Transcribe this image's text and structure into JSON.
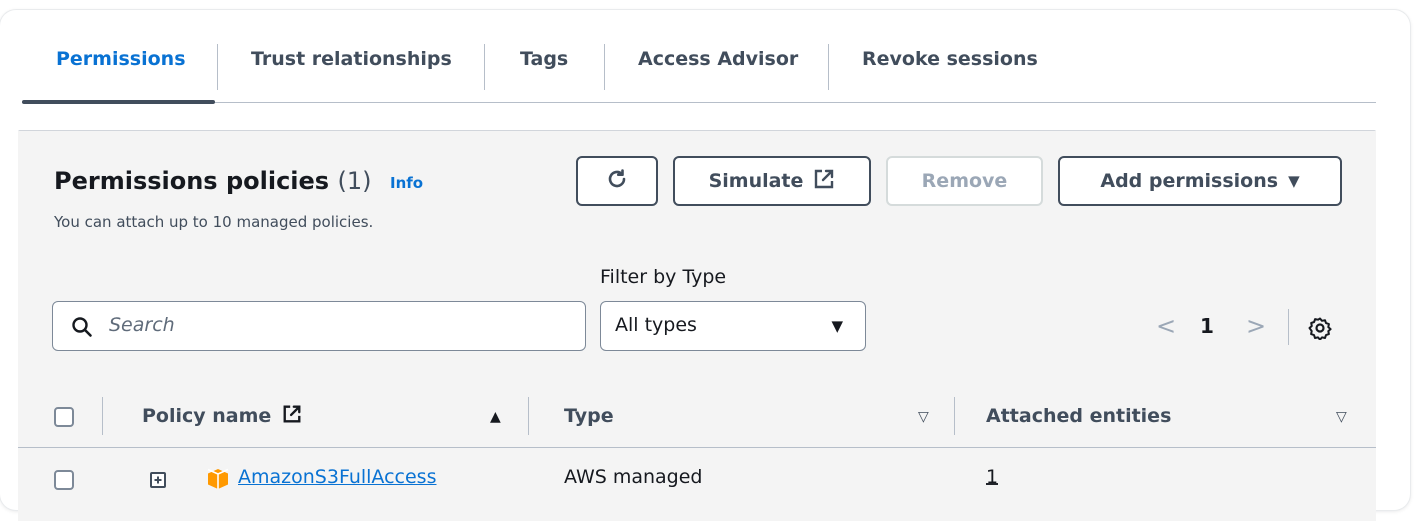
{
  "tabs": [
    {
      "label": "Permissions",
      "active": true
    },
    {
      "label": "Trust relationships",
      "active": false
    },
    {
      "label": "Tags",
      "active": false
    },
    {
      "label": "Access Advisor",
      "active": false
    },
    {
      "label": "Revoke sessions",
      "active": false
    }
  ],
  "panel": {
    "title": "Permissions policies",
    "count": "(1)",
    "info_link": "Info",
    "subtitle": "You can attach up to 10 managed policies."
  },
  "actions": {
    "refresh_icon": "refresh-icon",
    "simulate_label": "Simulate",
    "remove_label": "Remove",
    "add_permissions_label": "Add permissions"
  },
  "filter": {
    "label": "Filter by Type",
    "selected": "All types"
  },
  "search": {
    "placeholder": "Search"
  },
  "pagination": {
    "current_page": "1"
  },
  "table": {
    "columns": [
      {
        "label": "Policy name",
        "sort": "ascending"
      },
      {
        "label": "Type",
        "sort": "none"
      },
      {
        "label": "Attached entities",
        "sort": "none"
      }
    ],
    "rows": [
      {
        "policy_name": "AmazonS3FullAccess",
        "type": "AWS managed",
        "attached_entities": "1"
      }
    ]
  },
  "colors": {
    "accent": "#0972d3",
    "text": "#16191f",
    "muted": "#414d5c",
    "aws_icon": "#f90"
  }
}
